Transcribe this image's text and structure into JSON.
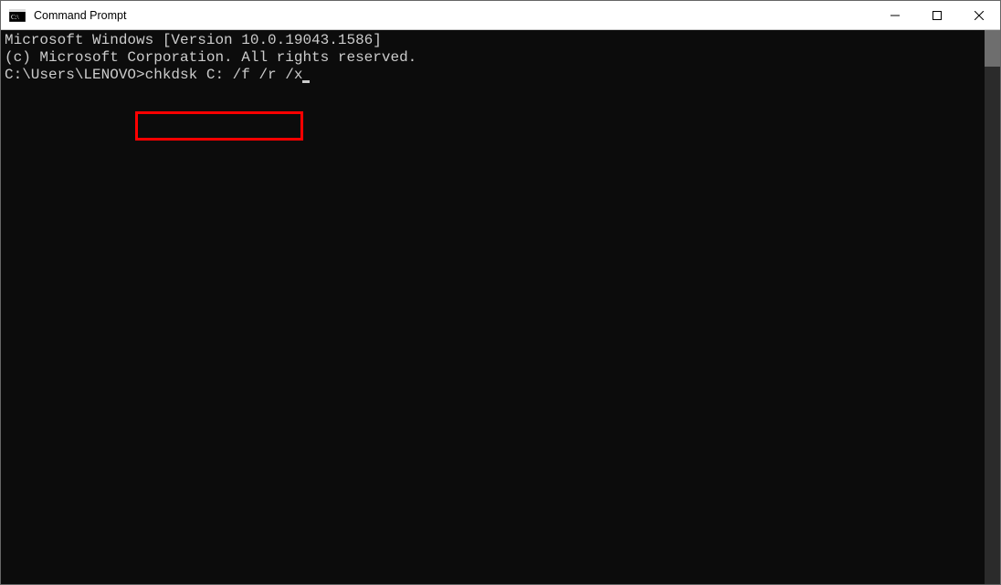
{
  "window": {
    "title": "Command Prompt"
  },
  "terminal": {
    "line1": "Microsoft Windows [Version 10.0.19043.1586]",
    "line2": "(c) Microsoft Corporation. All rights reserved.",
    "blank": "",
    "prompt": "C:\\Users\\LENOVO>",
    "command": "chkdsk C: /f /r /x"
  },
  "highlight": {
    "color": "#ff0000"
  }
}
